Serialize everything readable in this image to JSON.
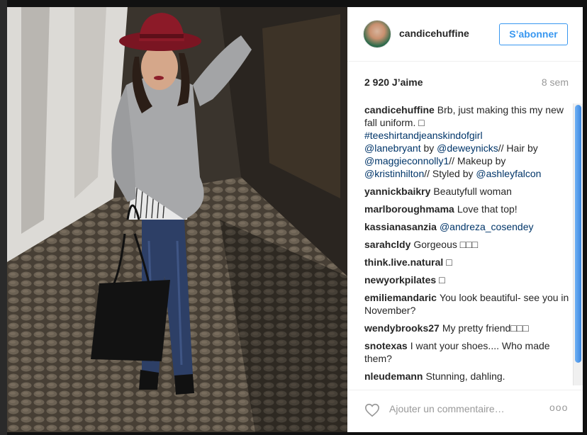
{
  "post": {
    "username": "candicehuffine",
    "follow_label": "S’abonner",
    "likes": "2 920 J’aime",
    "time": "8 sem",
    "add_comment_placeholder": "Ajouter un commentaire…",
    "more_label": "ooo",
    "caption": {
      "user": "candicehuffine",
      "text1": "Brb, just making this my new fall uniform. □",
      "hashtag": "#teeshirtandjeanskindofgirl",
      "mention1": "@lanebryant",
      "text2": " by ",
      "mention2": "@deweynicks",
      "text3": "// Hair by ",
      "mention3": "@maggieconnolly1",
      "text4": "// Makeup by ",
      "mention4": "@kristinhilton",
      "text5": "// Styled by ",
      "mention5": "@ashleyfalcon"
    },
    "comments": [
      {
        "user": "yannickbaikry",
        "text": "Beautyfull woman"
      },
      {
        "user": "marlboroughmama",
        "text": "Love that top!"
      },
      {
        "user": "kassianasanzia",
        "mention": "@andreza_cosendey"
      },
      {
        "user": "sarahcldy",
        "text": "Gorgeous □□□"
      },
      {
        "user": "think.live.natural",
        "text": "□"
      },
      {
        "user": "newyorkpilates",
        "text": "□"
      },
      {
        "user": "emiliemandaric",
        "text": "You look beautiful- see you in November?"
      },
      {
        "user": "wendybrooks27",
        "text": "My pretty friend□□□"
      },
      {
        "user": "snotexas",
        "text": "I want your shoes.... Who made them?"
      },
      {
        "user": "nleudemann",
        "text": "Stunning, dahling."
      }
    ]
  },
  "icons": {
    "heart": "heart-icon",
    "more": "more-options-icon"
  },
  "colors": {
    "accent": "#3897f0",
    "mention": "#003569",
    "muted": "#999999"
  }
}
